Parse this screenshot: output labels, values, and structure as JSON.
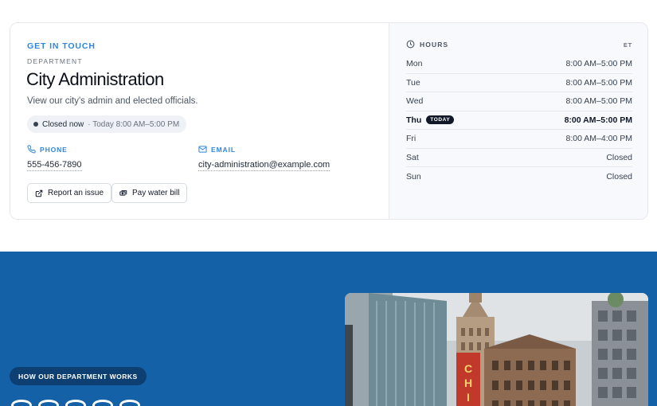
{
  "contact_card": {
    "eyebrow": "GET IN TOUCH",
    "department_label": "DEPARTMENT",
    "title": "City Administration",
    "description": "View our city's admin and elected officials.",
    "status": {
      "main": "Closed now",
      "sub": "· Today 8:00 AM–5:00 PM"
    },
    "phone": {
      "label": "PHONE",
      "value": "555-456-7890"
    },
    "email": {
      "label": "EMAIL",
      "value": "city-administration@example.com"
    },
    "actions": [
      {
        "label": "Report an issue",
        "icon": "external-link-icon"
      },
      {
        "label": "Pay water bill",
        "icon": "money-icon"
      }
    ]
  },
  "hours": {
    "heading": "HOURS",
    "timezone": "ET",
    "today_badge": "TODAY",
    "rows": [
      {
        "day": "Mon",
        "time": "8:00 AM–5:00 PM",
        "today": false
      },
      {
        "day": "Tue",
        "time": "8:00 AM–5:00 PM",
        "today": false
      },
      {
        "day": "Wed",
        "time": "8:00 AM–5:00 PM",
        "today": false
      },
      {
        "day": "Thu",
        "time": "8:00 AM–5:00 PM",
        "today": true
      },
      {
        "day": "Fri",
        "time": "8:00 AM–4:00 PM",
        "today": false
      },
      {
        "day": "Sat",
        "time": "Closed",
        "today": false
      },
      {
        "day": "Sun",
        "time": "Closed",
        "today": false
      }
    ]
  },
  "how_it_works": {
    "pill": "HOW OUR DEPARTMENT WORKS"
  },
  "colors": {
    "accent": "#2e86de",
    "band": "#1561a8",
    "band_pill": "#0d3f72"
  }
}
